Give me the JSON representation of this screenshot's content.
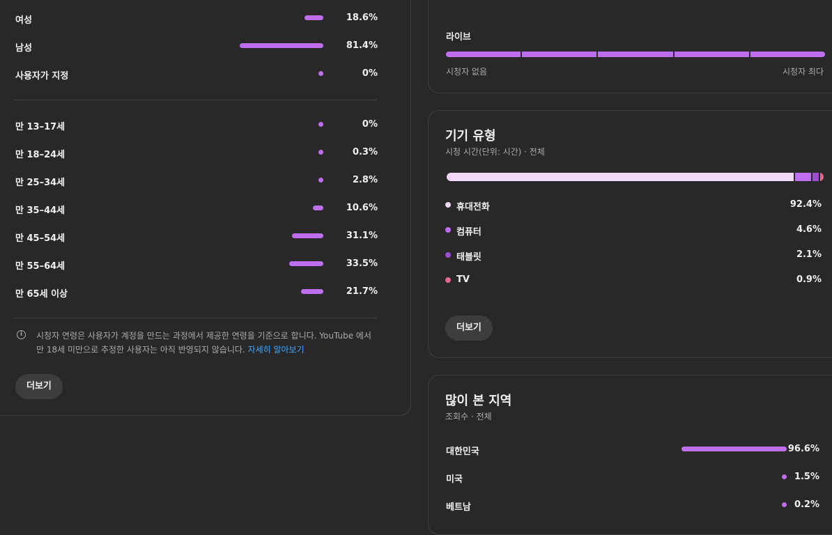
{
  "gender": {
    "rows": [
      {
        "label": "여성",
        "value": 18.6,
        "pct": "18.6%"
      },
      {
        "label": "남성",
        "value": 81.4,
        "pct": "81.4%"
      },
      {
        "label": "사용자가 지정",
        "value": 0,
        "pct": "0%"
      }
    ]
  },
  "age": {
    "rows": [
      {
        "label": "만 13–17세",
        "value": 0,
        "pct": "0%"
      },
      {
        "label": "만 18–24세",
        "value": 0.3,
        "pct": "0.3%"
      },
      {
        "label": "만 25–34세",
        "value": 2.8,
        "pct": "2.8%"
      },
      {
        "label": "만 35–44세",
        "value": 10.6,
        "pct": "10.6%"
      },
      {
        "label": "만 45–54세",
        "value": 31.1,
        "pct": "31.1%"
      },
      {
        "label": "만 55–64세",
        "value": 33.5,
        "pct": "33.5%"
      },
      {
        "label": "만 65세 이상",
        "value": 21.7,
        "pct": "21.7%"
      }
    ]
  },
  "age_note": {
    "text": "시청자 연령은 사용자가 계정을 만드는 과정에서 제공한 연령을 기준으로 합니다. YouTube 에서 만 18세 미만으로 추정한 사용자는 아직 반영되지 않습니다.",
    "link": "자세히 알아보기"
  },
  "left_more": "더보기",
  "live": {
    "label": "라이브",
    "min_label": "시청자 없음",
    "max_label": "시청자 최다"
  },
  "device": {
    "title": "기기 유형",
    "subtitle": "시청 시간(단위: 시간) · 전체",
    "items": [
      {
        "label": "휴대전화",
        "value": 92.4,
        "pct": "92.4%",
        "color": "#f2d9f7"
      },
      {
        "label": "컴퓨터",
        "value": 4.6,
        "pct": "4.6%",
        "color": "#c06ef0"
      },
      {
        "label": "태블릿",
        "value": 2.1,
        "pct": "2.1%",
        "color": "#9b4fd0"
      },
      {
        "label": "TV",
        "value": 0.9,
        "pct": "0.9%",
        "color": "#e3668f"
      }
    ],
    "more": "더보기"
  },
  "region": {
    "title": "많이 본 지역",
    "subtitle": "조회수 · 전체",
    "rows": [
      {
        "label": "대한민국",
        "value": 96.6,
        "pct": "96.6%"
      },
      {
        "label": "미국",
        "value": 1.5,
        "pct": "1.5%"
      },
      {
        "label": "베트남",
        "value": 0.2,
        "pct": "0.2%"
      }
    ]
  },
  "colors": {
    "accent": "#c06ef0",
    "link": "#3ea6ff"
  }
}
